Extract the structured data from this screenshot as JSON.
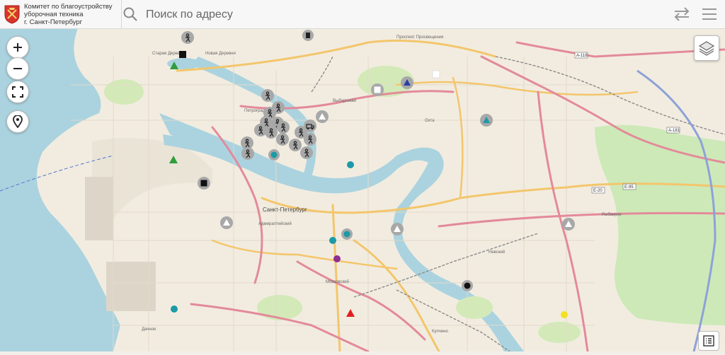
{
  "header": {
    "org_line1": "Комитет по благоустройству",
    "org_line2": "уборочная техника",
    "org_line3": "г. Санкт-Петербург",
    "emblem_icon": "coat-of-arms-icon"
  },
  "search": {
    "placeholder": "Поиск по адресу",
    "value": ""
  },
  "icons": {
    "search": "search-icon",
    "swap": "swap-icon",
    "menu": "menu-icon",
    "zoom_in": "plus-icon",
    "zoom_out": "minus-icon",
    "fullscreen": "fullscreen-icon",
    "locate": "location-pin-icon",
    "layers": "layers-icon",
    "legend": "legend-list-icon"
  },
  "map": {
    "labels": {
      "city": "Санкт-Петербург",
      "stariya_derevnya": "Старая Деревня",
      "novaya_derevnya": "Новая Деревня",
      "vyborgskaya": "Выборгская",
      "petrogradsky": "Петроградский",
      "prospekt_prosveshcheniya": "Проспект Просвещения",
      "okhta": "Охта",
      "nevsky": "Невский",
      "admiralteysky": "Адмиралтейский",
      "moskovsky": "Московский",
      "kupchino": "Купчино",
      "dachnoye": "Дачное",
      "rybatskoye": "Рыбацкое"
    },
    "route_labels": [
      "А-118",
      "Е-95",
      "Е-20",
      "А-181"
    ],
    "marker_colors": {
      "grey": "#9e9e9e",
      "green": "#2e9d3c",
      "blue": "#2a3fa5",
      "teal": "#1c9aa6",
      "red": "#e02020",
      "purple": "#8e2e8e",
      "yellow": "#f4e020",
      "black": "#111111"
    }
  }
}
